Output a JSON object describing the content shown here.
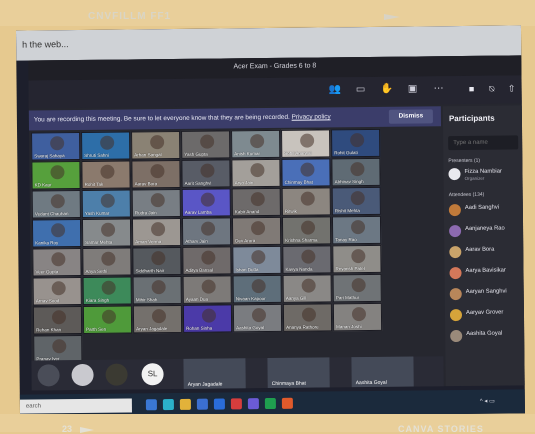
{
  "frame": {
    "top_caption": "CNVFILLM FF1",
    "page_number": "23",
    "bottom_right_caption": "CANVA STORIES"
  },
  "browser": {
    "address_text": "h the web..."
  },
  "teams": {
    "window_title": "Acer Exam - Grades 6 to 8",
    "toolbar_icons": [
      "people-icon",
      "chat-icon",
      "raise-hand-icon",
      "rooms-icon",
      "more-icon",
      "camera-icon",
      "mic-icon",
      "share-icon"
    ],
    "banner": {
      "message": "You are recording this meeting. Be sure to let everyone know that they are being recorded.",
      "link": "Privacy policy",
      "dismiss": "Dismiss"
    },
    "grid_tiles": [
      {
        "name": "Swaraj Sahaya",
        "color": "#3f5f9f"
      },
      {
        "name": "Shruti Sahni",
        "color": "#2d6ea8"
      },
      {
        "name": "Arhan Sangal",
        "color": "#8a8274"
      },
      {
        "name": "Yash Gupta",
        "color": "#6c6a6a"
      },
      {
        "name": "Anish Kumar",
        "color": "#7e8a90"
      },
      {
        "name": "Sohil Agarwal",
        "color": "#c8c3bd"
      },
      {
        "name": "Rohit Gulati",
        "color": "#2f4b7e"
      },
      {
        "name": "KD Kaur",
        "color": "#56a03c"
      },
      {
        "name": "Rohit Tak",
        "color": "#8b7a6d"
      },
      {
        "name": "Aarav Bora",
        "color": "#7d6f66"
      },
      {
        "name": "Aarit Sanghvi",
        "color": "#585c66"
      },
      {
        "name": "Arya Jain",
        "color": "#a39f9a"
      },
      {
        "name": "Chinmay Bhat",
        "color": "#4a6fb8"
      },
      {
        "name": "Abhinav Singh",
        "color": "#5f6b74"
      },
      {
        "name": "Vedant Chauhan",
        "color": "#6f7a82"
      },
      {
        "name": "Yash Kumar",
        "color": "#4d7faa"
      },
      {
        "name": "Rudra Jain",
        "color": "#787e84"
      },
      {
        "name": "Aarav Lamba",
        "color": "#5a56c6"
      },
      {
        "name": "Kabir Anand",
        "color": "#6d6a6a"
      },
      {
        "name": "Ritwik",
        "color": "#8c8680"
      },
      {
        "name": "Rishit Mehta",
        "color": "#4a5a78"
      },
      {
        "name": "Kanika Roy",
        "color": "#3f6fae"
      },
      {
        "name": "Samar Mehta",
        "color": "#868a8c"
      },
      {
        "name": "Aman Verma",
        "color": "#9c9792"
      },
      {
        "name": "Atharv Jain",
        "color": "#6e7680"
      },
      {
        "name": "Dev Arora",
        "color": "#807a76"
      },
      {
        "name": "Krishna Sharma",
        "color": "#72726e"
      },
      {
        "name": "Tanay Rao",
        "color": "#6c7884"
      },
      {
        "name": "Veer Gupta",
        "color": "#888484"
      },
      {
        "name": "Anya Sethi",
        "color": "#7f7c7a"
      },
      {
        "name": "Siddharth Nair",
        "color": "#55595e"
      },
      {
        "name": "Aditya Bansal",
        "color": "#6f6a6a"
      },
      {
        "name": "Ishan Dutta",
        "color": "#7e8a9a"
      },
      {
        "name": "Kavya Nanda",
        "color": "#6a6a70"
      },
      {
        "name": "Reyansh Patel",
        "color": "#8f8d89"
      },
      {
        "name": "Arnav Sood",
        "color": "#98928e"
      },
      {
        "name": "Kiara Singh",
        "color": "#3d8a5a"
      },
      {
        "name": "Mihir Shah",
        "color": "#6a7074"
      },
      {
        "name": "Ayaan Dua",
        "color": "#7d7a78"
      },
      {
        "name": "Nivaan Kapoor",
        "color": "#5e6e7a"
      },
      {
        "name": "Aanya Gill",
        "color": "#8a8886"
      },
      {
        "name": "Pari Mathur",
        "color": "#6f7376"
      },
      {
        "name": "Rehan Khan",
        "color": "#5d5a58"
      },
      {
        "name": "Parth Sen",
        "color": "#4f9a3a"
      },
      {
        "name": "Aryan Jagadale",
        "color": "#74706c"
      },
      {
        "name": "Rohan Sinha",
        "color": "#4b3aa8"
      },
      {
        "name": "Aashita Goyal",
        "color": "#7a7c80"
      },
      {
        "name": "Ananya Rathore",
        "color": "#6e6a66"
      },
      {
        "name": "Manan Joshi",
        "color": "#848280"
      },
      {
        "name": "Pranav Iyer",
        "color": "#5f6468"
      }
    ],
    "bottom_row": {
      "avatars": [
        {
          "initials": "",
          "color": "#4a4d58"
        },
        {
          "initials": "",
          "color": "#c9c9cf"
        },
        {
          "initials": "",
          "color": "#3b3a32"
        },
        {
          "initials": "SL",
          "color": "#f2f2f2"
        }
      ],
      "featured": [
        {
          "name": "Aryan Jagadale"
        },
        {
          "name": "Chinmaya Bhat"
        },
        {
          "name": "Aashita Goyal"
        }
      ]
    }
  },
  "participants_panel": {
    "title": "Participants",
    "search_placeholder": "Type a name",
    "presenters_label": "Presenters (1)",
    "presenter": {
      "name": "Fizza Nambiar",
      "role": "Organizer",
      "color": "#e9e9ee"
    },
    "attendees_label": "Attendees (134)",
    "attendees": [
      {
        "name": "Aadi Sanghvi",
        "color": "#c07a3a"
      },
      {
        "name": "Aanjaneya Rao",
        "color": "#8c6ab0"
      },
      {
        "name": "Aarav Bora",
        "color": "#c9a36a"
      },
      {
        "name": "Aarya Bavisikar",
        "color": "#d4785a"
      },
      {
        "name": "Aaryan Sanghvi",
        "color": "#b8865a"
      },
      {
        "name": "Aaryav Grover",
        "color": "#d6a43a"
      },
      {
        "name": "Aashita Goyal",
        "color": "#9a8a7a"
      }
    ]
  },
  "taskbar": {
    "search_text": "earch",
    "tray_text": "^ ◂ ▭"
  }
}
